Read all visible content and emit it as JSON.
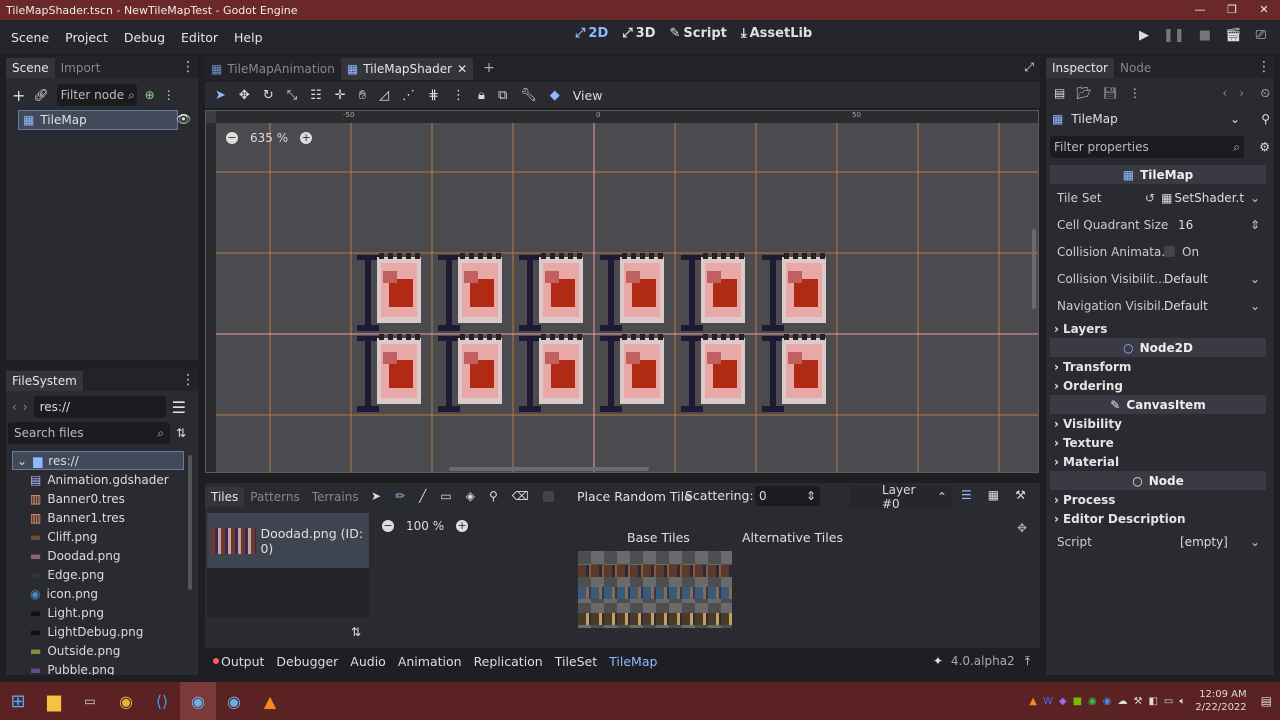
{
  "window": {
    "title": "TileMapShader.tscn - NewTileMapTest - Godot Engine"
  },
  "menu": [
    "Scene",
    "Project",
    "Debug",
    "Editor",
    "Help"
  ],
  "workspaces": [
    {
      "icon": "2d-icon",
      "label": "2D",
      "active": true
    },
    {
      "icon": "3d-icon",
      "label": "3D",
      "active": false
    },
    {
      "icon": "script-icon",
      "label": "Script",
      "active": false
    },
    {
      "icon": "assetlib-icon",
      "label": "AssetLib",
      "active": false
    }
  ],
  "scene_dock": {
    "tabs": [
      "Scene",
      "Import"
    ],
    "filter_placeholder": "Filter node",
    "root_node": "TileMap"
  },
  "filesystem": {
    "tab": "FileSystem",
    "path": "res://",
    "search_placeholder": "Search files",
    "root": "res://",
    "files": [
      "Animation.gdshader",
      "Banner0.tres",
      "Banner1.tres",
      "Cliff.png",
      "Doodad.png",
      "Edge.png",
      "icon.png",
      "Light.png",
      "LightDebug.png",
      "Outside.png",
      "Pubble.png"
    ]
  },
  "editor_tabs": {
    "tabs": [
      "TileMapAnimation",
      "TileMapShader"
    ],
    "active": 1
  },
  "viewport": {
    "toolbar_view": "View",
    "zoom": "635 %",
    "ruler_labels": [
      "-50",
      "0",
      "50"
    ]
  },
  "tilemap_panel": {
    "tabs": [
      "Tiles",
      "Patterns",
      "Terrains"
    ],
    "place_random": "Place Random Tile",
    "scattering_label": "Scattering:",
    "scattering_value": "0",
    "layer": "Layer #0",
    "source": "Doodad.png (ID: 0)",
    "zoom": "100 %",
    "base_tiles": "Base Tiles",
    "alt_tiles": "Alternative Tiles"
  },
  "bottom_bar": {
    "tabs": [
      "Output",
      "Debugger",
      "Audio",
      "Animation",
      "Replication",
      "TileSet",
      "TileMap"
    ],
    "active": "TileMap",
    "version": "4.0.alpha2"
  },
  "inspector": {
    "tabs": [
      "Inspector",
      "Node"
    ],
    "object": "TileMap",
    "filter_placeholder": "Filter properties",
    "class_head": "TileMap",
    "props": [
      {
        "label": "Tile Set",
        "value": "SetShader.t"
      },
      {
        "label": "Cell Quadrant Size",
        "value": "16"
      },
      {
        "label": "Collision Animata...",
        "value": "On"
      },
      {
        "label": "Collision Visibilit...",
        "value": "Default"
      },
      {
        "label": "Navigation Visibil...",
        "value": "Default"
      }
    ],
    "sections_tilemap": [
      "Layers"
    ],
    "node2d_head": "Node2D",
    "sections_node2d": [
      "Transform",
      "Ordering"
    ],
    "canvas_head": "CanvasItem",
    "sections_canvas": [
      "Visibility",
      "Texture",
      "Material"
    ],
    "node_head": "Node",
    "sections_node": [
      "Process",
      "Editor Description"
    ],
    "script_label": "Script",
    "script_value": "[empty]"
  },
  "taskbar": {
    "time": "12:09 AM",
    "date": "2/22/2022"
  },
  "colors": {
    "accent": "#8fb8ff",
    "titlebar": "#6b2828",
    "grid": "#d98a3a",
    "tile_red": "#b02a14"
  }
}
